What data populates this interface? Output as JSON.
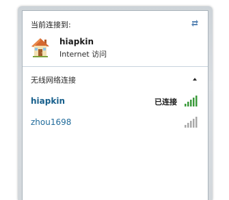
{
  "connection_panel": {
    "connected_header": "当前连接到:",
    "current_network": {
      "name": "hiapkin",
      "access": "Internet 访问",
      "icon": "house-icon"
    },
    "refresh_icon": "refresh-arrows-icon"
  },
  "wireless_section": {
    "title": "无线网络连接",
    "collapse_icon": "chevron-up-icon",
    "networks": [
      {
        "name": "hiapkin",
        "status": "已连接",
        "signal_bars": 5,
        "signal_color": "#3a9a3a"
      },
      {
        "name": "zhou1698",
        "status": "",
        "signal_bars": 5,
        "signal_color": "#a8a8a8"
      }
    ]
  },
  "colors": {
    "accent_link": "#1f6a9a",
    "signal_active": "#3a9a3a",
    "signal_inactive": "#a8a8a8"
  }
}
